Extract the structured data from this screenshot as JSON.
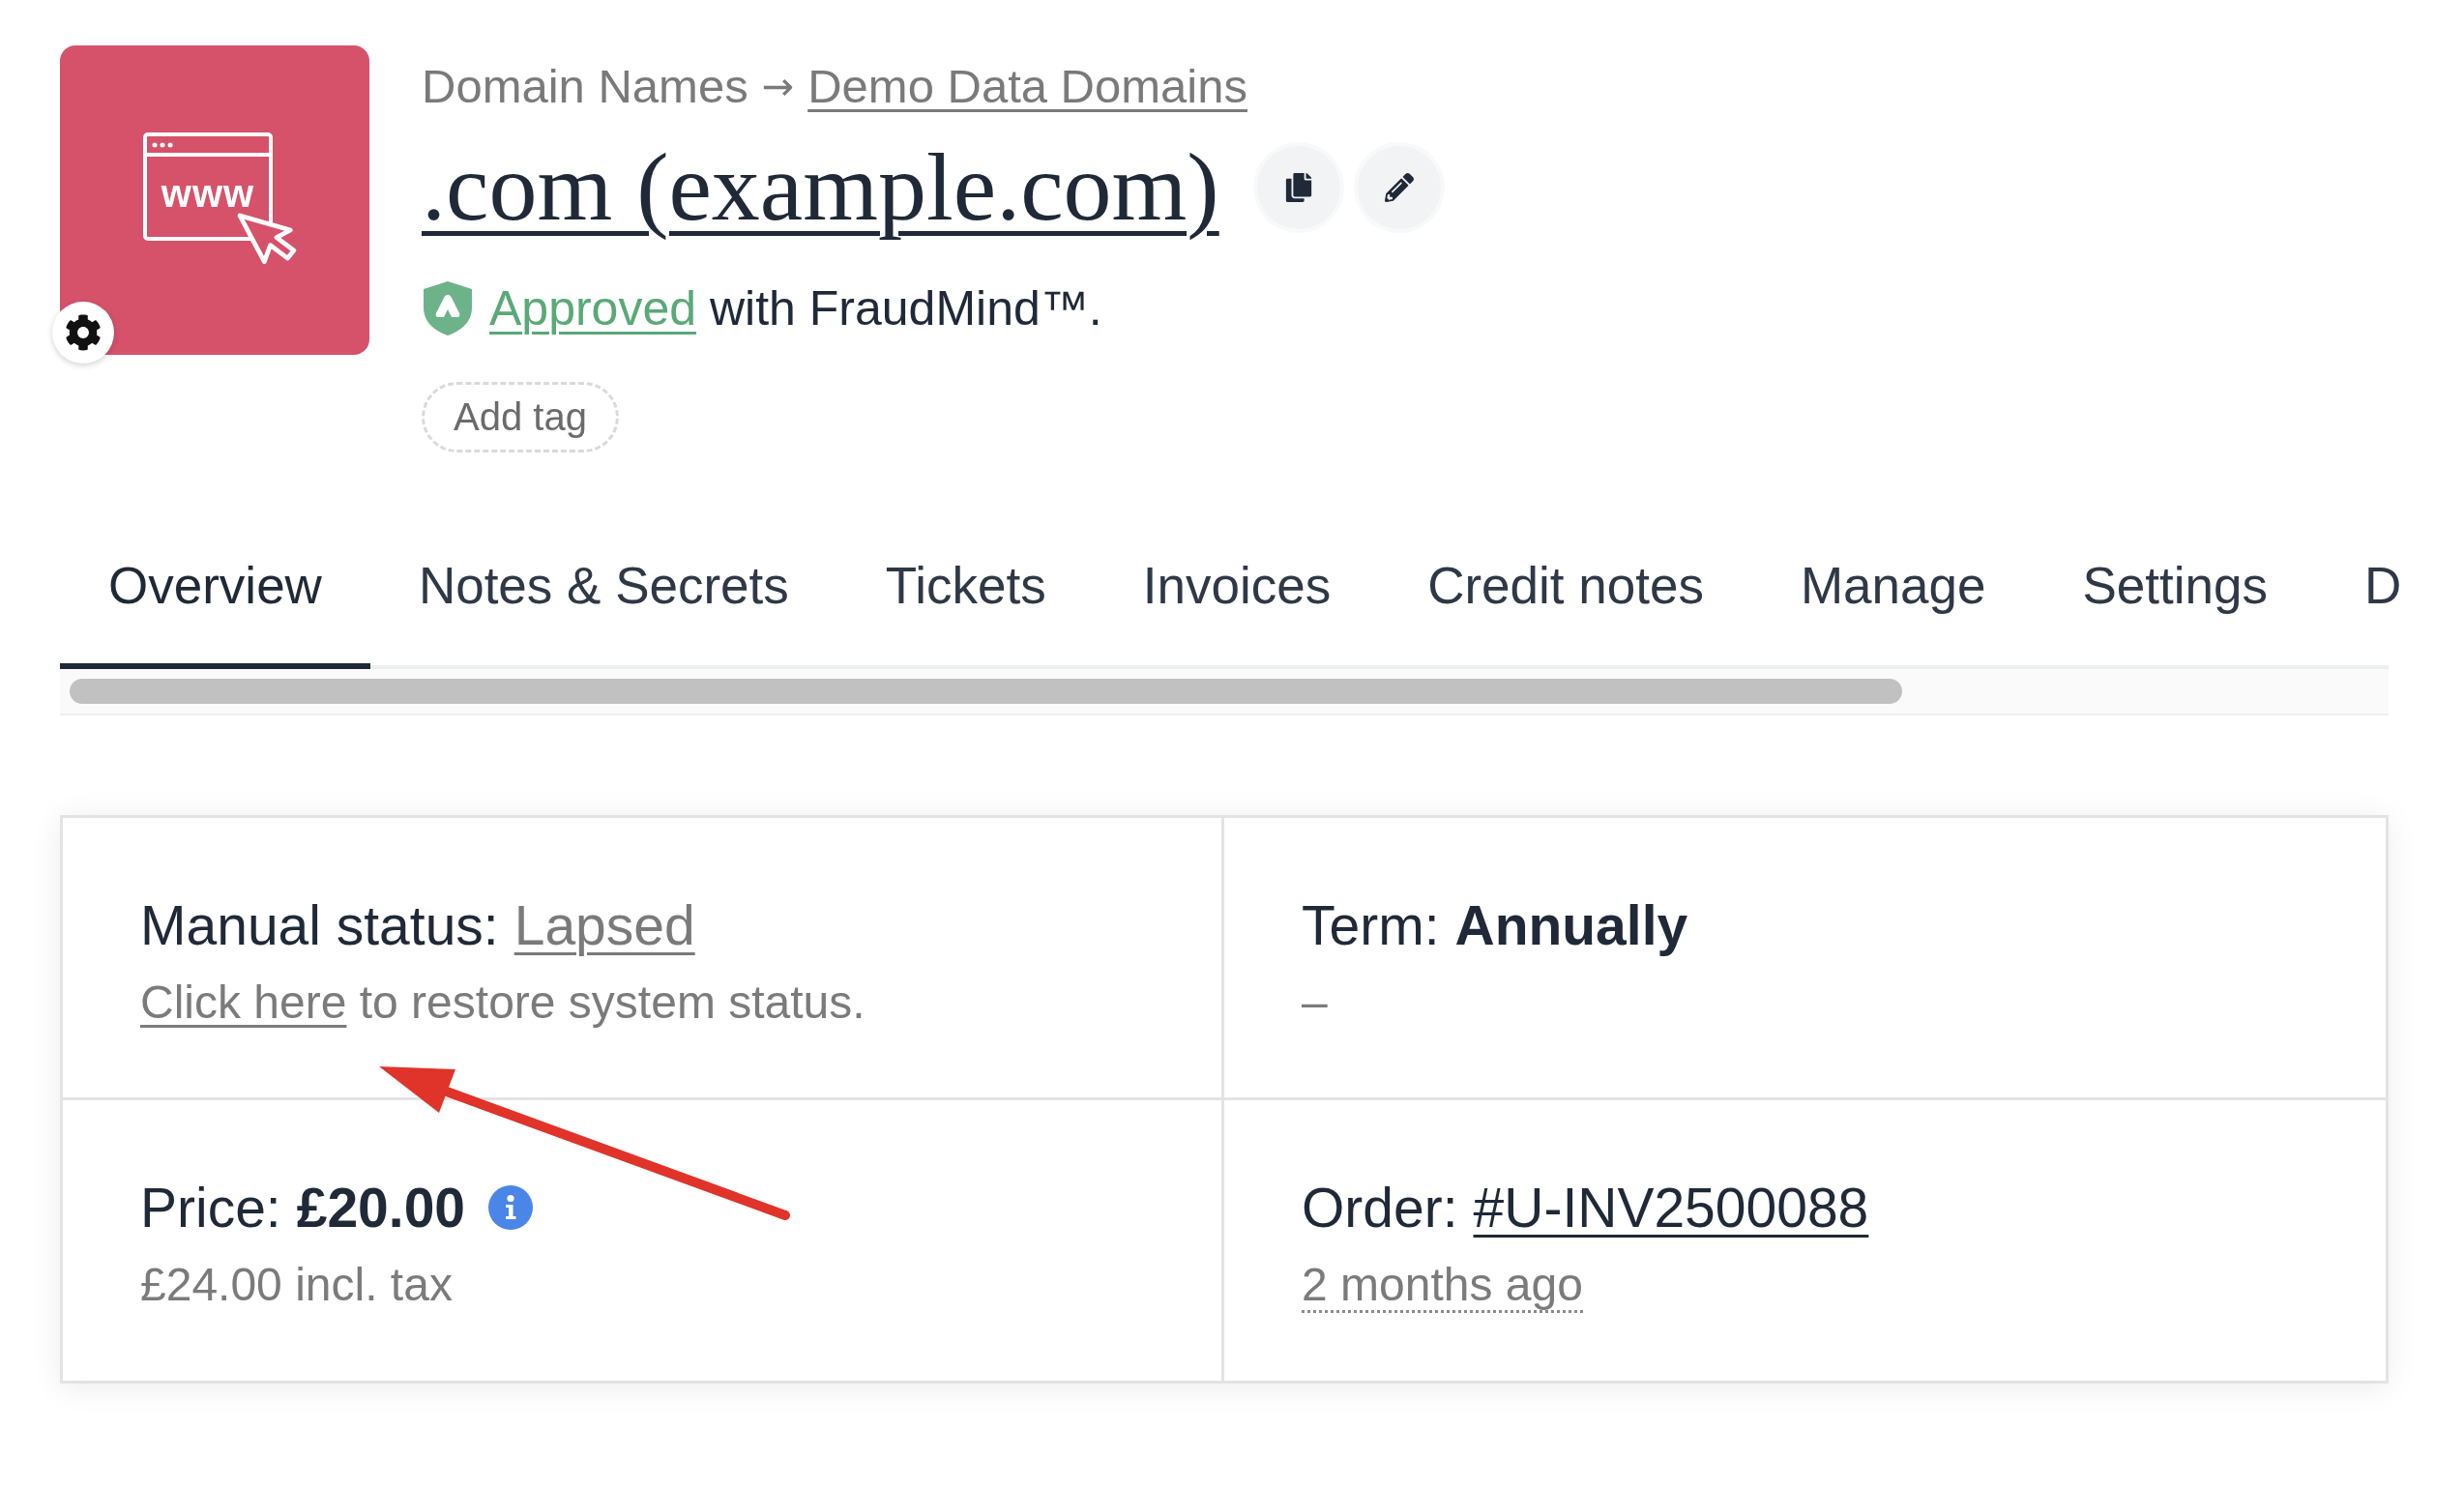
{
  "logo": {
    "text": "www"
  },
  "breadcrumb": {
    "parent": "Domain Names",
    "separator": "→",
    "link": "Demo Data Domains"
  },
  "title": ".com (example.com)",
  "fraud_check": {
    "status": "Approved",
    "text": "with FraudMind™."
  },
  "tag_button": "Add tag",
  "tabs": [
    {
      "label": "Overview",
      "selected": true
    },
    {
      "label": "Notes & Secrets",
      "selected": false
    },
    {
      "label": "Tickets",
      "selected": false
    },
    {
      "label": "Invoices",
      "selected": false
    },
    {
      "label": "Credit notes",
      "selected": false
    },
    {
      "label": "Manage",
      "selected": false
    },
    {
      "label": "Settings",
      "selected": false
    },
    {
      "label": "D",
      "selected": false
    }
  ],
  "details": [
    {
      "label": "Manual status:",
      "value": {
        "kind": "muted_link",
        "text": "Lapsed"
      },
      "info": false,
      "note": {
        "kind": "action",
        "link": "Click here",
        "text": "to restore system status."
      }
    },
    {
      "label": "Term:",
      "value": {
        "kind": "strong",
        "text": "Annually"
      },
      "info": false,
      "note": {
        "kind": "plain",
        "text": "–"
      }
    },
    {
      "label": "Price:",
      "value": {
        "kind": "strong",
        "text": "£20.00"
      },
      "info": true,
      "note": {
        "kind": "plain",
        "text": "£24.00 incl. tax"
      }
    },
    {
      "label": "Order:",
      "value": {
        "kind": "link",
        "text": "#U-INV2500088"
      },
      "info": false,
      "note": {
        "kind": "time",
        "text": "2 months ago"
      }
    }
  ]
}
